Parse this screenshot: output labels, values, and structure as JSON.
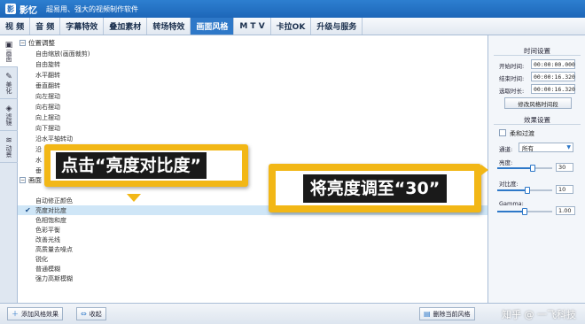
{
  "app": {
    "logo_char": "影",
    "name": "影忆",
    "tagline": "超易用、强大的视频制作软件"
  },
  "menu": [
    {
      "label": "视 频"
    },
    {
      "label": "音 频"
    },
    {
      "label": "字幕特效"
    },
    {
      "label": "叠加素材"
    },
    {
      "label": "转场特效"
    },
    {
      "label": "画面风格",
      "active": true
    },
    {
      "label": "M T V"
    },
    {
      "label": "卡拉OK"
    },
    {
      "label": "升级与服务"
    }
  ],
  "left_tabs": [
    {
      "icon": "▣",
      "label": "画面",
      "active": true
    },
    {
      "icon": "✎",
      "label": "美化"
    },
    {
      "icon": "◈",
      "label": "滤镜"
    },
    {
      "icon": "≋",
      "label": "动景"
    }
  ],
  "list": {
    "group1": "位置调整",
    "group1_items": [
      "自由缩放(画面裁剪)",
      "自由旋转",
      "水平翻转",
      "垂直翻转",
      "向左摆动",
      "向右摆动",
      "向上摆动",
      "向下摆动",
      "沿水平轴转动",
      "沿",
      "水",
      "垂"
    ],
    "group2": "画面",
    "group2_items": [
      "",
      "自动修正颜色",
      "亮度对比度",
      "色相饱和度",
      "色彩平衡",
      "改善光线",
      "高质量去噪点",
      "锐化",
      "普通模糊",
      "强力高斯模糊"
    ],
    "selected_index": 2
  },
  "right_panel": {
    "time_title": "时间设置",
    "start_label": "开始时间:",
    "start_value": "00:00:00.000",
    "end_label": "结束时间:",
    "end_value": "00:00:16.320",
    "duration_label": "选取时长:",
    "duration_value": "00:00:16.320",
    "modify_button": "修改风格时间段",
    "effect_title": "效果设置",
    "soft_transition": "柔和过渡",
    "channel_label": "通道:",
    "channel_value": "所有",
    "brightness_label": "亮度:",
    "brightness_value": "30",
    "contrast_label": "对比度:",
    "contrast_value": "10",
    "gamma_label": "Gamma:",
    "gamma_value": "1.00",
    "brightness_level": 0.65,
    "contrast_level": 0.55,
    "gamma_level": 0.5
  },
  "bottom": {
    "add_button": "添加风格效果",
    "collapse_button": "收起",
    "delete_button": "删除当前风格",
    "watermark": "知乎 @ 一飞科技"
  },
  "callouts": {
    "first": "点击“亮度对比度”",
    "second": "将亮度调至“30”"
  },
  "colors": {
    "accent": "#2e78c8",
    "callout": "#f2b716",
    "selected_row": "#cfe6f7"
  }
}
